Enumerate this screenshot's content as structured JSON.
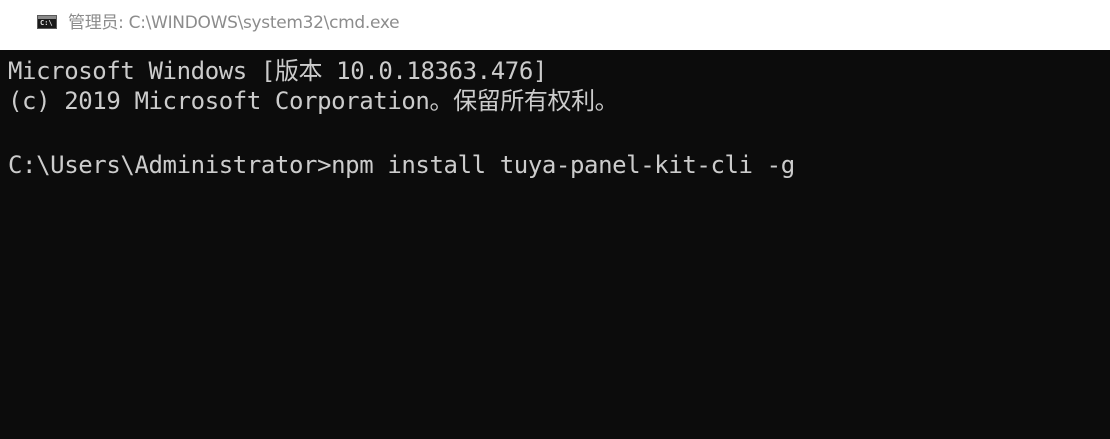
{
  "window": {
    "title": "管理员: C:\\WINDOWS\\system32\\cmd.exe",
    "icon": "cmd-icon",
    "icon_glyph": "C:\\"
  },
  "console": {
    "background": "#0c0c0c",
    "foreground": "#cccccc",
    "lines": [
      "Microsoft Windows [版本 10.0.18363.476]",
      "(c) 2019 Microsoft Corporation。保留所有权利。",
      "C:\\Users\\Administrator>npm install tuya-panel-kit-cli -g"
    ]
  }
}
